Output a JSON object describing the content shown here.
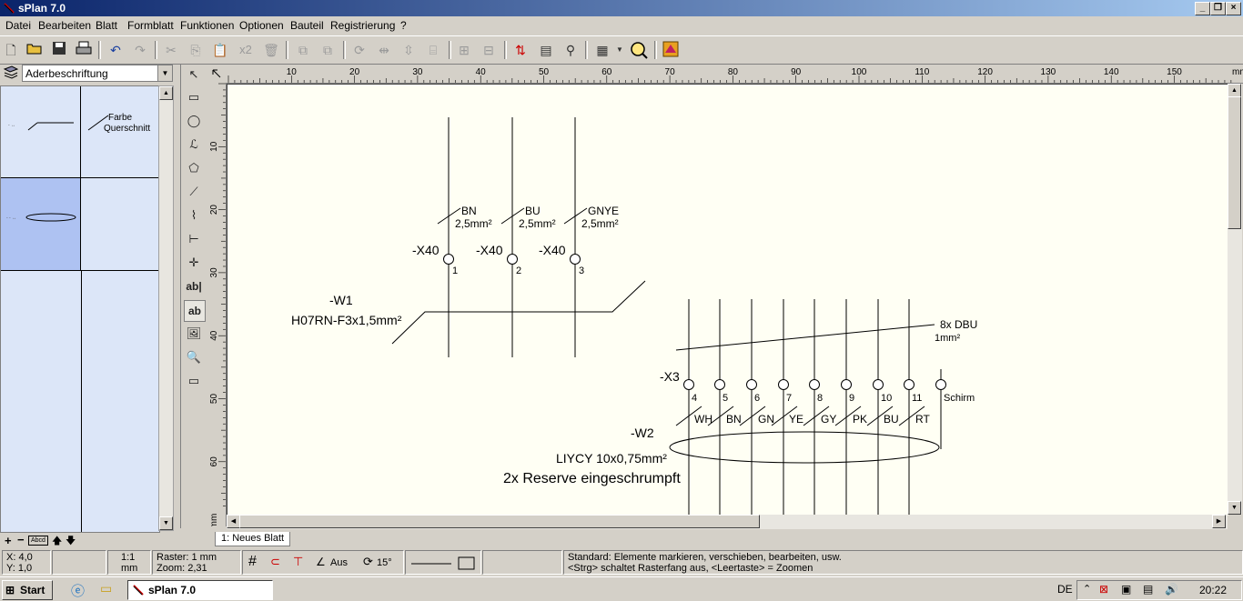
{
  "window": {
    "title": "sPlan 7.0"
  },
  "menu": [
    "Datei",
    "Bearbeiten",
    "Blatt",
    "Formblatt",
    "Funktionen",
    "Optionen",
    "Bauteil",
    "Registrierung",
    "?"
  ],
  "toolbar": {
    "multiplier_label": "x2"
  },
  "library": {
    "selected": "Aderbeschriftung",
    "cell_label_line1": "Farbe",
    "cell_label_line2": "Querschnitt"
  },
  "left_footer": {
    "add": "+",
    "remove": "−",
    "badge": "Abcd"
  },
  "vertical_tools": {
    "text_tool_1": "ab|",
    "text_tool_2": "ab"
  },
  "ruler": {
    "h_ticks": [
      "10",
      "20",
      "30",
      "40",
      "50",
      "60",
      "70",
      "80",
      "90",
      "100",
      "110",
      "120",
      "130",
      "140",
      "150"
    ],
    "h_unit": "mm",
    "v_ticks": [
      "10",
      "20",
      "30",
      "40",
      "50",
      "60"
    ],
    "v_unit": "mm"
  },
  "drawing": {
    "x40_label": "-X40",
    "x40_pins": [
      "1",
      "2",
      "3"
    ],
    "x40_colors": [
      "BN",
      "BU",
      "GNYE"
    ],
    "x40_cross": "2,5mm²",
    "w1_name": "-W1",
    "w1_type": "H07RN-F3x1,5mm²",
    "dbu_label": "8x DBU",
    "dbu_cross": "1mm²",
    "x3_label": "-X3",
    "x3_pins": [
      "4",
      "5",
      "6",
      "7",
      "8",
      "9",
      "10",
      "11"
    ],
    "x3_shield": "Schirm",
    "x3_colors": [
      "WH",
      "BN",
      "GN",
      "YE",
      "GY",
      "PK",
      "BU",
      "RT"
    ],
    "w2_name": "-W2",
    "w2_type": "LIYCY 10x0,75mm²",
    "note": "2x Reserve eingeschrumpft"
  },
  "sheet_tab": "1: Neues Blatt",
  "status": {
    "x": "X: 4,0",
    "y": "Y: 1,0",
    "scale": "1:1",
    "unit": "mm",
    "raster": "Raster: 1 mm",
    "zoom": "Zoom:      2,31",
    "angle_mode": "Aus",
    "angle": "15°",
    "hint1": "Standard: Elemente markieren, verschieben, bearbeiten, usw.",
    "hint2": "<Strg> schaltet Rasterfang aus, <Leertaste> = Zoomen"
  },
  "taskbar": {
    "start": "Start",
    "app": "sPlan 7.0",
    "lang": "DE",
    "time": "20:22"
  }
}
